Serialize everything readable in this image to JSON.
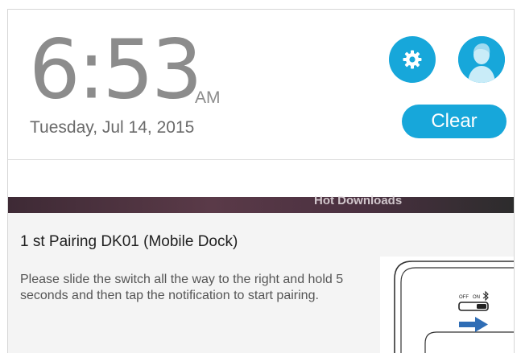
{
  "clock": {
    "time": "6:53",
    "ampm": "AM",
    "date": "Tuesday, Jul 14, 2015"
  },
  "buttons": {
    "settings_icon": "gear-icon",
    "avatar_icon": "user-profile-icon",
    "clear_label": "Clear"
  },
  "background_peek": {
    "text": "Hot Downloads"
  },
  "notification": {
    "title": "1 st Pairing DK01 (Mobile Dock)",
    "body": "Please slide the switch all the way to the right and hold 5 seconds and then tap the notification to start pairing.",
    "image_labels": {
      "off": "OFF",
      "on": "ON"
    },
    "image_icons": [
      "bluetooth-icon",
      "right-arrow-icon"
    ]
  },
  "colors": {
    "accent": "#17a7da",
    "clock_text": "#8c8c8c",
    "notification_bg": "#f4f4f4"
  }
}
